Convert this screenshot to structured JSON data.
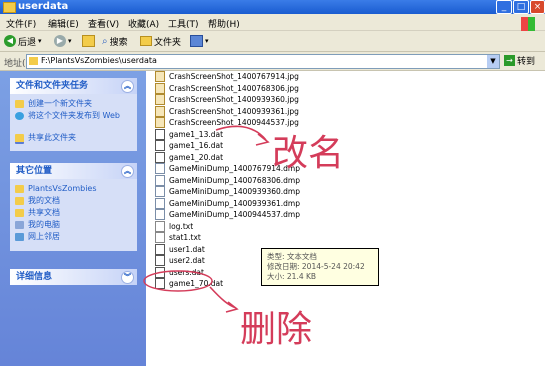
{
  "window": {
    "title": "userdata"
  },
  "menu": [
    "文件(F)",
    "编辑(E)",
    "查看(V)",
    "收藏(A)",
    "工具(T)",
    "帮助(H)"
  ],
  "toolbar": {
    "back": "后退",
    "search": "搜索",
    "folders": "文件夹"
  },
  "address": {
    "label": "地址(D)",
    "path": "F:\\PlantsVsZombies\\userdata",
    "go": "转到"
  },
  "tasks_panel": {
    "title": "文件和文件夹任务",
    "items": [
      "创建一个新文件夹",
      "将这个文件夹发布到 Web",
      "共享此文件夹"
    ]
  },
  "other_places": {
    "title": "其它位置",
    "items": [
      "PlantsVsZombies",
      "我的文档",
      "共享文档",
      "我的电脑",
      "网上邻居"
    ]
  },
  "details": {
    "title": "详细信息"
  },
  "files": [
    {
      "name": "CrashScreenShot_1400767914.jpg",
      "type": "img"
    },
    {
      "name": "CrashScreenShot_1400768306.jpg",
      "type": "img"
    },
    {
      "name": "CrashScreenShot_1400939360.jpg",
      "type": "img"
    },
    {
      "name": "CrashScreenShot_1400939361.jpg",
      "type": "img"
    },
    {
      "name": "CrashScreenShot_1400944537.jpg",
      "type": "img"
    },
    {
      "name": "game1_13.dat",
      "type": "dat"
    },
    {
      "name": "game1_16.dat",
      "type": "dat"
    },
    {
      "name": "game1_20.dat",
      "type": "dat"
    },
    {
      "name": "GameMiniDump_1400767914.dmp",
      "type": "dmp"
    },
    {
      "name": "GameMiniDump_1400768306.dmp",
      "type": "dmp"
    },
    {
      "name": "GameMiniDump_1400939360.dmp",
      "type": "dmp"
    },
    {
      "name": "GameMiniDump_1400939361.dmp",
      "type": "dmp"
    },
    {
      "name": "GameMiniDump_1400944537.dmp",
      "type": "dmp"
    },
    {
      "name": "log.txt",
      "type": "txt"
    },
    {
      "name": "stat1.txt",
      "type": "txt"
    },
    {
      "name": "user1.dat",
      "type": "dat"
    },
    {
      "name": "user2.dat",
      "type": "dat"
    },
    {
      "name": "users.dat",
      "type": "dat"
    },
    {
      "name": "game1_70.dat",
      "type": "dat"
    }
  ],
  "tooltip": {
    "type": "类型: 文本文档",
    "modified": "修改日期: 2014-5-24 20:42",
    "size": "大小: 21.4 KB"
  },
  "annotations": {
    "rename": "改名",
    "delete": "删除"
  }
}
